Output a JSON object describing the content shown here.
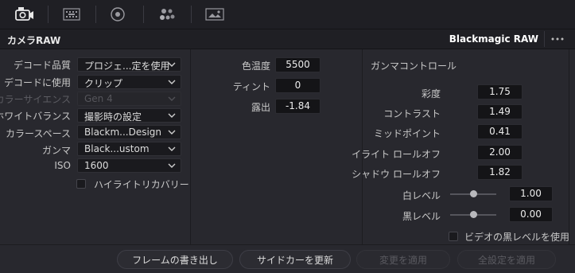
{
  "toolbar": {
    "icons": [
      "camera-raw-icon",
      "grid-icon",
      "circle-dot-icon",
      "dots-cluster-icon",
      "image-icon"
    ]
  },
  "header": {
    "title": "カメラRAW",
    "format": "Blackmagic RAW",
    "more": "•••"
  },
  "decode": {
    "quality": {
      "label": "デコード品質",
      "value": "プロジェ...定を使用"
    },
    "use": {
      "label": "デコードに使用",
      "value": "クリップ"
    },
    "color_science": {
      "label": "カラーサイエンス",
      "value": "Gen 4"
    },
    "white_balance": {
      "label": "ホワイトバランス",
      "value": "撮影時の設定"
    },
    "color_space": {
      "label": "カラースペース",
      "value": "Blackm...Design"
    },
    "gamma": {
      "label": "ガンマ",
      "value": "Black...ustom"
    },
    "iso": {
      "label": "ISO",
      "value": "1600"
    },
    "highlight_recovery": {
      "label": "ハイライトリカバリー",
      "checked": false
    }
  },
  "basic": {
    "color_temp": {
      "label": "色温度",
      "value": "5500"
    },
    "tint": {
      "label": "ティント",
      "value": "0"
    },
    "exposure": {
      "label": "露出",
      "value": "-1.84"
    }
  },
  "gamma_controls": {
    "heading": "ガンマコントロール",
    "saturation": {
      "label": "彩度",
      "value": "1.75"
    },
    "contrast": {
      "label": "コントラスト",
      "value": "1.49"
    },
    "midpoint": {
      "label": "ミッドポイント",
      "value": "0.41"
    },
    "highlight_rolloff": {
      "label": "イライト ロールオフ",
      "value": "2.00"
    },
    "shadow_rolloff": {
      "label": "シャドウ ロールオフ",
      "value": "1.82"
    },
    "white_level": {
      "label": "白レベル",
      "value": "1.00",
      "level": 1.0
    },
    "black_level": {
      "label": "黒レベル",
      "value": "0.00",
      "level": 0.0
    },
    "video_black": {
      "label": "ビデオの黒レベルを使用",
      "checked": false
    }
  },
  "footer": {
    "export_frame": "フレームの書き出し",
    "update_sidecar": "サイドカーを更新",
    "apply_changes": "変更を適用",
    "apply_all": "全設定を適用"
  }
}
